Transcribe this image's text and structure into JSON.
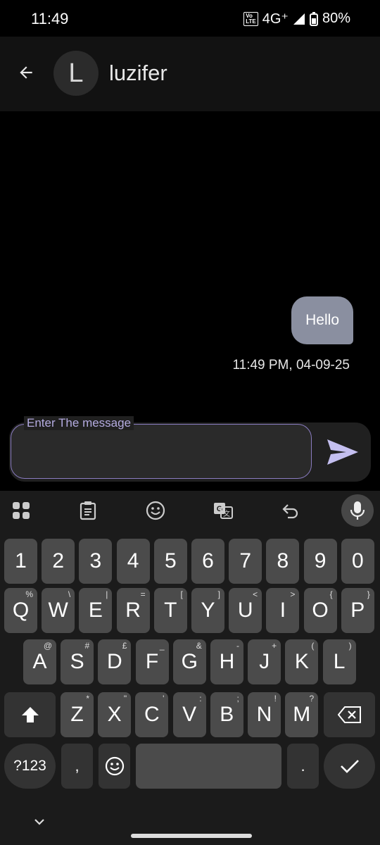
{
  "status_bar": {
    "time": "11:49",
    "volte_top": "Vo",
    "volte_bottom": "LTE",
    "network": "4G⁺",
    "battery": "80%"
  },
  "header": {
    "avatar_letter": "L",
    "contact_name": "luzifer"
  },
  "messages": [
    {
      "text": "Hello",
      "time": "11:49 PM, 04-09-25",
      "sent": true
    }
  ],
  "composer": {
    "label": "Enter The message",
    "value": ""
  },
  "keyboard": {
    "number_row": [
      "1",
      "2",
      "3",
      "4",
      "5",
      "6",
      "7",
      "8",
      "9",
      "0"
    ],
    "row1": [
      {
        "k": "Q",
        "h": "%"
      },
      {
        "k": "W",
        "h": "\\"
      },
      {
        "k": "E",
        "h": "|"
      },
      {
        "k": "R",
        "h": "="
      },
      {
        "k": "T",
        "h": "["
      },
      {
        "k": "Y",
        "h": "]"
      },
      {
        "k": "U",
        "h": "<"
      },
      {
        "k": "I",
        "h": ">"
      },
      {
        "k": "O",
        "h": "{"
      },
      {
        "k": "P",
        "h": "}"
      }
    ],
    "row2": [
      {
        "k": "A",
        "h": "@"
      },
      {
        "k": "S",
        "h": "#"
      },
      {
        "k": "D",
        "h": "£"
      },
      {
        "k": "F",
        "h": "_"
      },
      {
        "k": "G",
        "h": "&"
      },
      {
        "k": "H",
        "h": "-"
      },
      {
        "k": "J",
        "h": "+"
      },
      {
        "k": "K",
        "h": "("
      },
      {
        "k": "L",
        "h": ")"
      }
    ],
    "row3": [
      {
        "k": "Z",
        "h": "*"
      },
      {
        "k": "X",
        "h": "\""
      },
      {
        "k": "C",
        "h": "'"
      },
      {
        "k": "V",
        "h": ":"
      },
      {
        "k": "B",
        "h": ";"
      },
      {
        "k": "N",
        "h": "!"
      },
      {
        "k": "M",
        "h": "?"
      }
    ],
    "symbols_label": "?123",
    "comma": ",",
    "period": "."
  },
  "colors": {
    "bubble": "#8a8fa0",
    "accent": "#b4abe0",
    "send": "#c4bff0"
  }
}
